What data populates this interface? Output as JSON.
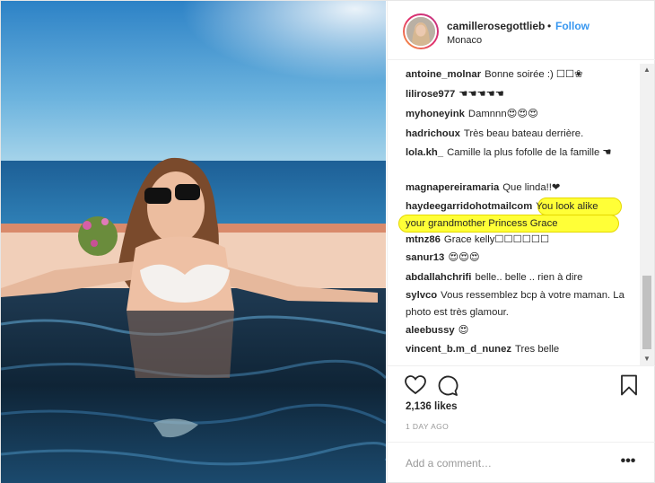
{
  "post": {
    "username": "camillerosegottlieb",
    "separator": "•",
    "follow_label": "Follow",
    "location": "Monaco"
  },
  "comments": [
    {
      "user": "antoine_molnar",
      "text": "Bonne soirée :) ☐☐❀"
    },
    {
      "user": "lilirose977",
      "text": "☚☚☚☚☚"
    },
    {
      "user": "myhoneyink",
      "text": "Damnnn😍😍😍"
    },
    {
      "user": "hadrichoux",
      "text": "Très beau bateau derrière."
    },
    {
      "user": "lola.kh_",
      "text": "Camille la plus fofolle de la famille ☚"
    },
    {
      "user": "magnapereiramaria",
      "text": "Que linda!!❤"
    },
    {
      "user": "haydeegarridohotmailcom",
      "text": "You look alike your grandmother Princess Grace"
    },
    {
      "user": "mtnz86",
      "text": "Grace kelly☐☐☐☐☐☐"
    },
    {
      "user": "sanur13",
      "text": "😍😍😍"
    },
    {
      "user": "abdallahchrifi",
      "text": "belle.. belle .. rien à dire"
    },
    {
      "user": "sylvco",
      "text": "Vous ressemblez bcp à votre maman. La photo est très glamour."
    },
    {
      "user": "aleebussy",
      "text": "😍"
    },
    {
      "user": "vincent_b.m_d_nunez",
      "text": "Tres belle"
    }
  ],
  "highlight_part1": "You look alike",
  "highlight_part2": "your grandmother Princess Grace",
  "scrollbar": {
    "up_arrow": "▲",
    "down_arrow": "▼"
  },
  "actions": {
    "like_icon": "heart-icon",
    "comment_icon": "comment-icon",
    "save_icon": "bookmark-icon",
    "likes": "2,136 likes",
    "time_ago": "1 DAY AGO",
    "add_comment_placeholder": "Add a comment…",
    "more_label": "•••"
  },
  "colors": {
    "link_blue": "#3897f0",
    "highlight_yellow": "#ffff37",
    "text": "#262626",
    "muted": "#999999"
  }
}
